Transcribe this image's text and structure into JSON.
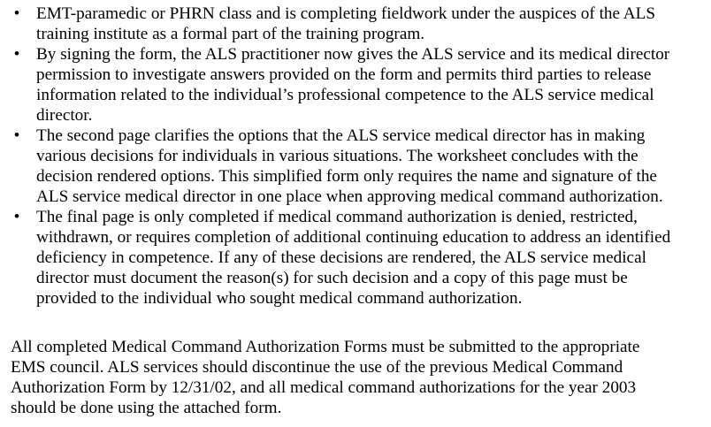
{
  "bullet_symbol": "•",
  "bullets": [
    {
      "lines": [
        "EMT-paramedic or PHRN class and is completing fieldwork under the auspices of the ALS",
        "training institute as a formal part of the training program."
      ]
    },
    {
      "lines": [
        "By signing the form, the ALS practitioner now gives the ALS service and its medical director",
        "permission to investigate answers provided on the form and permits third parties to release",
        "information related to the individual’s professional competence to the ALS service medical",
        "director."
      ]
    },
    {
      "lines": [
        "The second page clarifies the options that the ALS service medical director has in making",
        "various decisions for individuals in various situations. The worksheet concludes with the",
        "decision rendered options. This simplified form only requires the name and signature of the",
        "ALS service medical director in one place when approving medical command authorization."
      ]
    },
    {
      "lines": [
        "The final page is only completed if medical command authorization is denied, restricted,",
        "withdrawn, or requires completion of additional continuing education to address an identified",
        "deficiency in competence.  If any of these decisions are rendered, the ALS service medical",
        "director must document the reason(s) for such decision and a copy of this page must be",
        "provided to the individual who sought medical command authorization."
      ]
    }
  ],
  "closing_paragraph": {
    "lines": [
      "All completed Medical Command Authorization Forms must be submitted to the appropriate",
      "EMS council. ALS services should discontinue the use of the previous Medical Command",
      "Authorization Form by 12/31/02, and all medical command authorizations for the year 2003",
      "should be done using the attached form."
    ]
  }
}
